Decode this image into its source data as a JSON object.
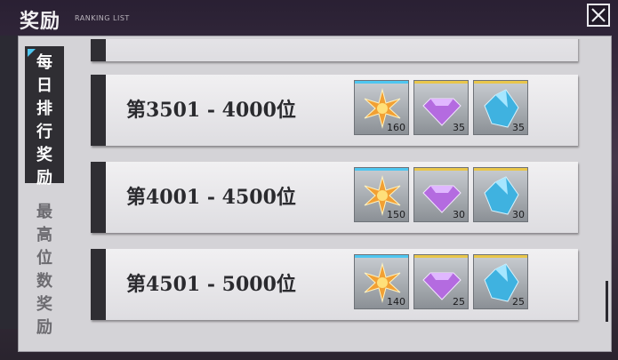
{
  "header": {
    "title": "奖励",
    "subtitle": "RANKING LIST"
  },
  "colors": {
    "accent_blue": "#4ec6f0",
    "accent_gold": "#e9c64a",
    "tab_active_bg": "#2f2e33"
  },
  "tabs": [
    {
      "label": "每日排行奖励",
      "chars": [
        "每",
        "日",
        "排",
        "行",
        "奖",
        "励"
      ],
      "active": true
    },
    {
      "label": "最高位数奖励",
      "chars": [
        "最",
        "高",
        "位",
        "数",
        "奖",
        "励"
      ],
      "active": false
    }
  ],
  "rewards": [
    {
      "rank_label": "第3501 - 4000位",
      "items": [
        {
          "icon": "orange-star-icon",
          "qty": "160",
          "bar": "blue"
        },
        {
          "icon": "purple-diamond-icon",
          "qty": "35",
          "bar": "gold"
        },
        {
          "icon": "blue-crystal-icon",
          "qty": "35",
          "bar": "gold"
        }
      ]
    },
    {
      "rank_label": "第4001 - 4500位",
      "items": [
        {
          "icon": "orange-star-icon",
          "qty": "150",
          "bar": "blue"
        },
        {
          "icon": "purple-diamond-icon",
          "qty": "30",
          "bar": "gold"
        },
        {
          "icon": "blue-crystal-icon",
          "qty": "30",
          "bar": "gold"
        }
      ]
    },
    {
      "rank_label": "第4501 - 5000位",
      "items": [
        {
          "icon": "orange-star-icon",
          "qty": "140",
          "bar": "blue"
        },
        {
          "icon": "purple-diamond-icon",
          "qty": "25",
          "bar": "gold"
        },
        {
          "icon": "blue-crystal-icon",
          "qty": "25",
          "bar": "gold"
        }
      ]
    }
  ]
}
